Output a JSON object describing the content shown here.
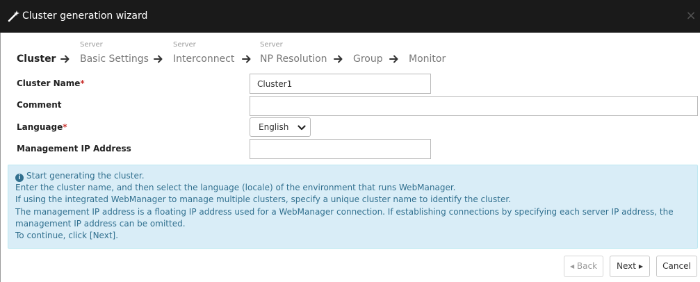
{
  "dialog": {
    "title": "Cluster generation wizard",
    "close_symbol": "×",
    "title_icon": "wand-icon"
  },
  "steps": [
    {
      "sub": "",
      "label": "Cluster",
      "active": true
    },
    {
      "sub": "Server",
      "label": "Basic Settings",
      "active": false
    },
    {
      "sub": "Server",
      "label": "Interconnect",
      "active": false
    },
    {
      "sub": "Server",
      "label": "NP Resolution",
      "active": false
    },
    {
      "sub": "",
      "label": "Group",
      "active": false
    },
    {
      "sub": "",
      "label": "Monitor",
      "active": false
    }
  ],
  "form": {
    "cluster_name": {
      "label": "Cluster Name",
      "required_mark": "*",
      "value": "Cluster1"
    },
    "comment": {
      "label": "Comment",
      "value": ""
    },
    "language": {
      "label": "Language",
      "required_mark": "*",
      "value": "English"
    },
    "management_ip": {
      "label": "Management IP Address",
      "value": ""
    }
  },
  "info": {
    "icon": "info-circle-icon",
    "lines": [
      "Start generating the cluster.",
      "Enter the cluster name, and then select the language (locale) of the environment that runs WebManager.",
      "If using the integrated WebManager to manage multiple clusters, specify a unique cluster name to identify the cluster.",
      "The management IP address is a floating IP address used for a WebManager connection. If establishing connections by specifying each server IP address, the management IP address can be omitted.",
      "To continue, click [Next]."
    ]
  },
  "buttons": {
    "back": "Back",
    "next": "Next",
    "cancel": "Cancel"
  },
  "colors": {
    "title_bar": "#1a1a1a",
    "info_bg": "#d9edf7",
    "info_text": "#31708f",
    "required": "#c9302c"
  }
}
